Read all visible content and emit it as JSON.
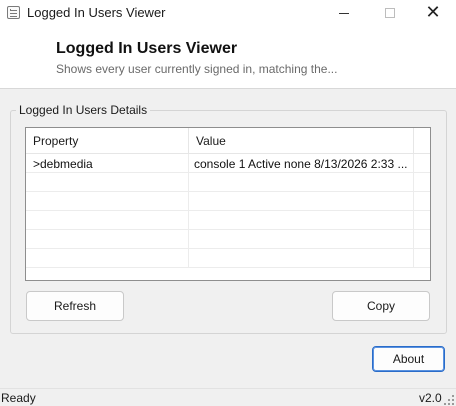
{
  "window": {
    "title": "Logged In Users Viewer",
    "minimize_glyph": "",
    "close_glyph": "✕"
  },
  "header": {
    "title": "Logged In Users Viewer",
    "subtitle": "Shows every user currently signed in, matching the..."
  },
  "group": {
    "legend": "Logged In Users Details"
  },
  "list": {
    "columns": [
      "Property",
      "Value",
      ""
    ],
    "rows": [
      {
        "property": ">debmedia",
        "value": "console 1 Active none 8/13/2026 2:33 ..."
      },
      {
        "property": "",
        "value": ""
      },
      {
        "property": "",
        "value": ""
      },
      {
        "property": "",
        "value": ""
      },
      {
        "property": "",
        "value": ""
      },
      {
        "property": "",
        "value": ""
      }
    ]
  },
  "buttons": {
    "refresh": "Refresh",
    "copy": "Copy",
    "about": "About"
  },
  "status": {
    "text": "Ready",
    "version": "v2.0"
  },
  "colors": {
    "accent_border": "#2a6cc9",
    "window_bg": "#f0f0f0",
    "header_bg": "#ffffff"
  }
}
